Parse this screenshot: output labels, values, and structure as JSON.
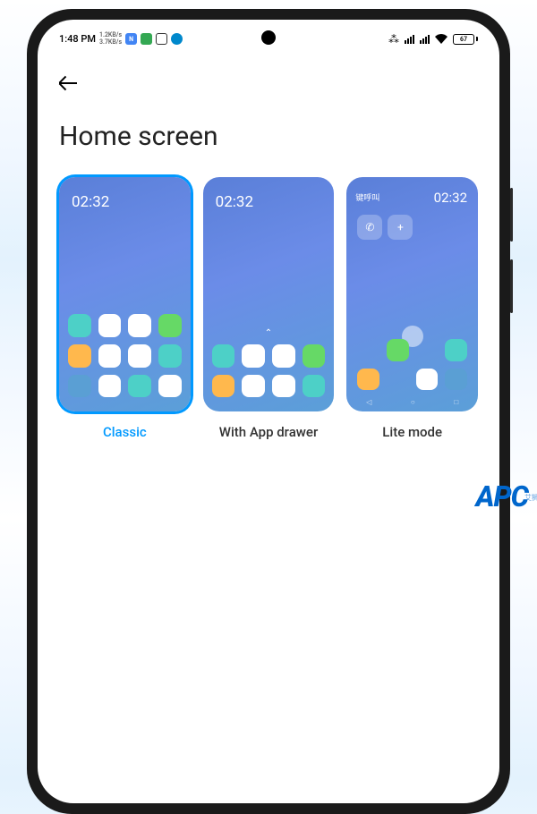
{
  "status_bar": {
    "time": "1:48 PM",
    "net_speed_up": "1.2KB/s",
    "net_speed_down": "3.7KB/s",
    "battery_level": "67"
  },
  "page": {
    "title": "Home screen"
  },
  "options": [
    {
      "label": "Classic",
      "preview_time": "02:32",
      "selected": true
    },
    {
      "label": "With App drawer",
      "preview_time": "02:32",
      "selected": false
    },
    {
      "label": "Lite mode",
      "preview_time": "02:32",
      "preview_text": "键呼叫",
      "selected": false
    }
  ],
  "watermark": {
    "main": "APC",
    "sub": "艾狮"
  }
}
